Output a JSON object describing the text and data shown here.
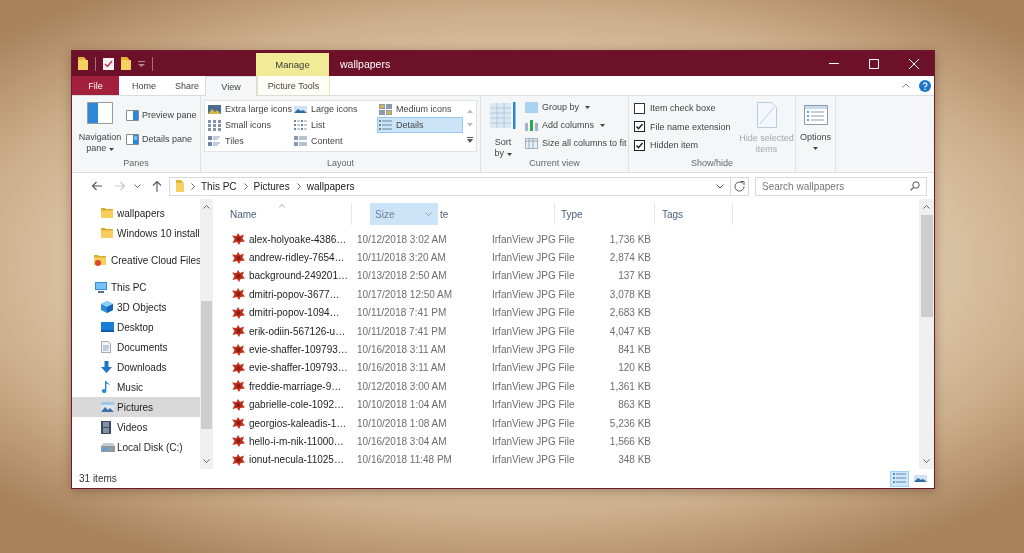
{
  "window": {
    "title": "wallpapers",
    "context_tab": "Manage"
  },
  "ribbon_tabs": [
    {
      "label": "File",
      "kind": "file",
      "selected": false
    },
    {
      "label": "Home",
      "kind": "tab",
      "selected": false
    },
    {
      "label": "Share",
      "kind": "tab",
      "selected": false
    },
    {
      "label": "View",
      "kind": "tab",
      "selected": true
    },
    {
      "label": "Picture Tools",
      "kind": "context",
      "selected": false
    }
  ],
  "ribbon": {
    "panes": {
      "label": "Panes",
      "navigation_pane": "Navigation pane",
      "buttons": [
        {
          "label": "Preview pane",
          "kind": "preview"
        },
        {
          "label": "Details pane",
          "kind": "details"
        }
      ]
    },
    "layout": {
      "label": "Layout",
      "options": [
        {
          "label": "Extra large icons",
          "kind": "xlarge",
          "selected": false
        },
        {
          "label": "Large icons",
          "kind": "large",
          "selected": false
        },
        {
          "label": "Medium icons",
          "kind": "medium",
          "selected": false
        },
        {
          "label": "Small icons",
          "kind": "small",
          "selected": false
        },
        {
          "label": "List",
          "kind": "list",
          "selected": false
        },
        {
          "label": "Details",
          "kind": "details",
          "selected": true
        },
        {
          "label": "Tiles",
          "kind": "tiles",
          "selected": false
        },
        {
          "label": "Content",
          "kind": "content",
          "selected": false
        }
      ]
    },
    "current_view": {
      "label": "Current view",
      "sort_by": "Sort by",
      "commands": [
        {
          "label": "Group by",
          "kind": "group",
          "dropdown": true
        },
        {
          "label": "Add columns",
          "kind": "columns",
          "dropdown": true
        },
        {
          "label": "Size all columns to fit",
          "kind": "fit",
          "dropdown": false
        }
      ]
    },
    "show_hide": {
      "label": "Show/hide",
      "checkboxes": [
        {
          "label": "Item check boxe",
          "checked": false
        },
        {
          "label": "File name extension",
          "checked": true
        },
        {
          "label": "Hidden item",
          "checked": true
        }
      ],
      "hide_selected": {
        "label": "Hide selected items",
        "disabled": true
      }
    },
    "options": {
      "label": "Options"
    }
  },
  "navigation": {
    "back": {
      "disabled": false
    },
    "forward": {
      "disabled": true
    }
  },
  "address_bar": {
    "path": [
      "This PC",
      "Pictures",
      "wallpapers"
    ]
  },
  "search": {
    "placeholder": "Search wallpapers"
  },
  "sidebar": {
    "items": [
      {
        "children": [
          {
            "label": "wallpapers",
            "kind": "folder",
            "selected": false
          },
          {
            "label": "Windows 10 install",
            "kind": "folder",
            "selected": false
          }
        ]
      },
      {
        "label": "Creative Cloud Files",
        "kind": "cloud",
        "selected": false
      },
      {
        "label": "This PC",
        "kind": "computer",
        "selected": false,
        "children": [
          {
            "label": "3D Objects",
            "kind": "cube",
            "selected": false
          },
          {
            "label": "Desktop",
            "kind": "desktop",
            "selected": false
          },
          {
            "label": "Documents",
            "kind": "documents",
            "selected": false
          },
          {
            "label": "Downloads",
            "kind": "downloads",
            "selected": false
          },
          {
            "label": "Music",
            "kind": "music",
            "selected": false
          },
          {
            "label": "Pictures",
            "kind": "pictures",
            "selected": true
          },
          {
            "label": "Videos",
            "kind": "videos",
            "selected": false
          },
          {
            "label": "Local Disk (C:)",
            "kind": "drive",
            "selected": false
          }
        ]
      }
    ]
  },
  "file_list": {
    "columns": [
      {
        "label": "Name",
        "sorted": true
      },
      {
        "label": "te",
        "sorted": false
      },
      {
        "label": "Type",
        "sorted": false
      },
      {
        "label": "Tags",
        "sorted": false
      }
    ],
    "dragged_column": {
      "label": "Size"
    },
    "rows": [
      {
        "name": "alex-holyoake-4386…",
        "date": "10/12/2018 3:02 AM",
        "type": "IrfanView JPG File",
        "size": "1,736 KB"
      },
      {
        "name": "andrew-ridley-7654…",
        "date": "10/11/2018 3:20 AM",
        "type": "IrfanView JPG File",
        "size": "2,874 KB"
      },
      {
        "name": "background-249201…",
        "date": "10/13/2018 2:50 AM",
        "type": "IrfanView JPG File",
        "size": "137 KB"
      },
      {
        "name": "dmitri-popov-3677…",
        "date": "10/17/2018 12:50 AM",
        "type": "IrfanView JPG File",
        "size": "3,078 KB"
      },
      {
        "name": "dmitri-popov-1094…",
        "date": "10/11/2018 7:41 PM",
        "type": "IrfanView JPG File",
        "size": "2,683 KB"
      },
      {
        "name": "erik-odiin-567126-u…",
        "date": "10/11/2018 7:41 PM",
        "type": "IrfanView JPG File",
        "size": "4,047 KB"
      },
      {
        "name": "evie-shaffer-109793…",
        "date": "10/16/2018 3:11 AM",
        "type": "IrfanView JPG File",
        "size": "841 KB"
      },
      {
        "name": "evie-shaffer-109793…",
        "date": "10/16/2018 3:11 AM",
        "type": "IrfanView JPG File",
        "size": "120 KB"
      },
      {
        "name": "freddie-marriage-9…",
        "date": "10/12/2018 3:00 AM",
        "type": "IrfanView JPG File",
        "size": "1,361 KB"
      },
      {
        "name": "gabrielle-cole-1092…",
        "date": "10/10/2018 1:04 AM",
        "type": "IrfanView JPG File",
        "size": "863 KB"
      },
      {
        "name": "georgios-kaleadis-1…",
        "date": "10/10/2018 1:08 AM",
        "type": "IrfanView JPG File",
        "size": "5,236 KB"
      },
      {
        "name": "hello-i-m-nik-11000…",
        "date": "10/16/2018 3:04 AM",
        "type": "IrfanView JPG File",
        "size": "1,566 KB"
      },
      {
        "name": "ionut-necula-11025…",
        "date": "10/16/2018 11:48 PM",
        "type": "IrfanView JPG File",
        "size": "348 KB"
      }
    ]
  },
  "status_bar": {
    "item_count": "31 items",
    "views": [
      {
        "kind": "details",
        "selected": true
      },
      {
        "kind": "large",
        "selected": false
      }
    ]
  }
}
